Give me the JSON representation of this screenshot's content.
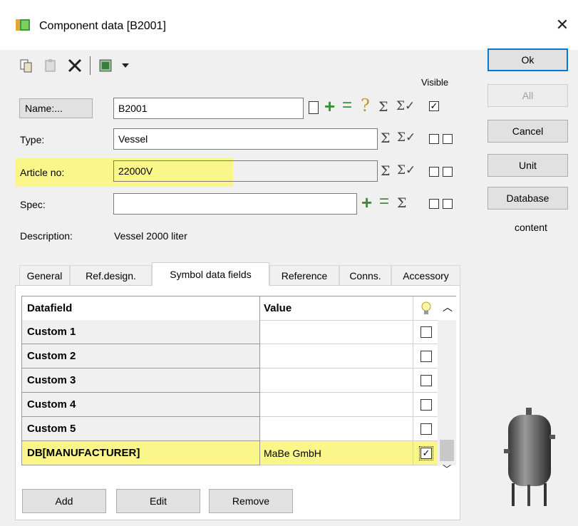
{
  "window": {
    "title": "Component data [B2001]",
    "close_glyph": "✕"
  },
  "toolbar": {
    "icons": [
      "copy-icon",
      "paste-icon",
      "delete-icon",
      "database-icon",
      "dropdown-arrow-icon"
    ]
  },
  "side_buttons": {
    "ok": "Ok",
    "all": "All",
    "cancel": "Cancel",
    "unit": "Unit",
    "database": "Database",
    "content": "content"
  },
  "form": {
    "visible_header": "Visible",
    "name_button": "Name:...",
    "name_value": "B2001",
    "type_label": "Type:",
    "type_value": "Vessel",
    "article_label": "Article no:",
    "article_value": "22000V",
    "spec_label": "Spec:",
    "spec_value": "",
    "description_label": "Description:",
    "description_value": "Vessel 2000 liter",
    "symbols": {
      "plus": "+",
      "minus": "=",
      "question": "?",
      "sigma": "Σ",
      "sigma_check": "Σ✓",
      "check": "✓"
    }
  },
  "tabs": [
    "General",
    "Ref.design.",
    "Symbol data fields",
    "Reference",
    "Conns.",
    "Accessory"
  ],
  "active_tab": "Symbol data fields",
  "grid": {
    "headers": {
      "datafield": "Datafield",
      "value": "Value"
    },
    "rows": [
      {
        "name": "Custom 1",
        "value": "",
        "visible": false
      },
      {
        "name": "Custom 2",
        "value": "",
        "visible": false
      },
      {
        "name": "Custom 3",
        "value": "",
        "visible": false
      },
      {
        "name": "Custom 4",
        "value": "",
        "visible": false
      },
      {
        "name": "Custom 5",
        "value": "",
        "visible": false
      },
      {
        "name": "DB[MANUFACTURER]",
        "value": "MaBe GmbH",
        "visible": true
      }
    ]
  },
  "grid_buttons": {
    "add": "Add",
    "edit": "Edit",
    "remove": "Remove"
  },
  "colors": {
    "highlight": "#fbf68a",
    "accent": "#0078d7"
  }
}
